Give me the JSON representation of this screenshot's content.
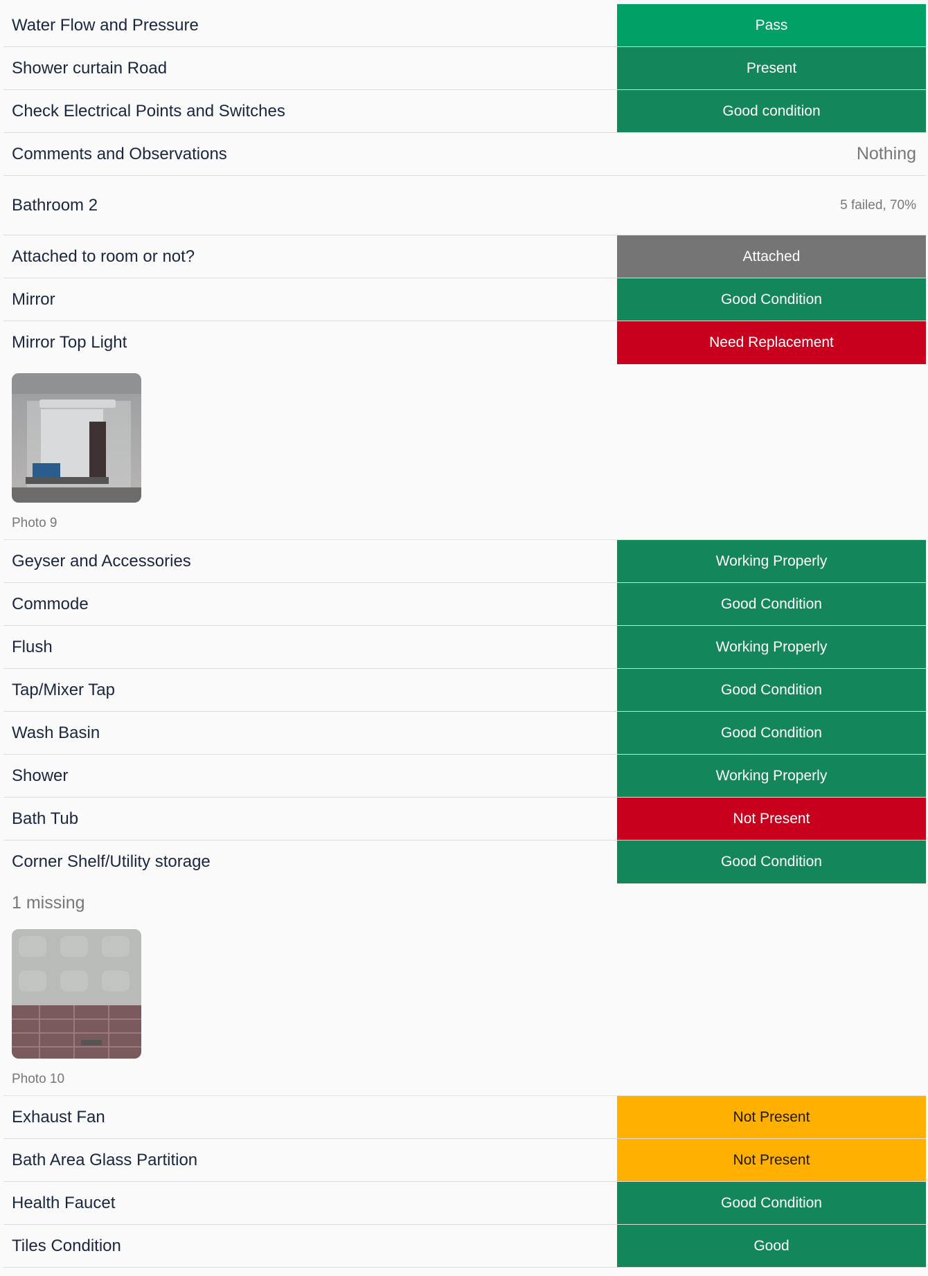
{
  "colors": {
    "pass": "#00a066",
    "good": "#14875a",
    "fail": "#c8001e",
    "warn": "#ffb000",
    "neutral": "#757575"
  },
  "top_rows": [
    {
      "label": "Water Flow and Pressure",
      "status": "Pass",
      "kind": "pass"
    },
    {
      "label": "Shower curtain Road",
      "status": "Present",
      "kind": "good"
    },
    {
      "label": "Check Electrical Points and Switches",
      "status": "Good condition",
      "kind": "good"
    },
    {
      "label": "Comments and Observations",
      "status": "Nothing",
      "kind": "text"
    }
  ],
  "section": {
    "title": "Bathroom 2",
    "summary": "5 failed, 70%"
  },
  "rows_a": [
    {
      "label": "Attached to room or not?",
      "status": "Attached",
      "kind": "neutral"
    },
    {
      "label": "Mirror",
      "status": "Good Condition",
      "kind": "good"
    },
    {
      "label": "Mirror Top Light",
      "status": "Need Replacement",
      "kind": "fail"
    }
  ],
  "photo_9": {
    "caption": "Photo 9",
    "icon": "mirror-photo"
  },
  "rows_b": [
    {
      "label": "Geyser and Accessories",
      "status": "Working Properly",
      "kind": "good"
    },
    {
      "label": "Commode",
      "status": "Good Condition",
      "kind": "good"
    },
    {
      "label": "Flush",
      "status": "Working Properly",
      "kind": "good"
    },
    {
      "label": "Tap/Mixer Tap",
      "status": "Good Condition",
      "kind": "good"
    },
    {
      "label": "Wash Basin",
      "status": "Good Condition",
      "kind": "good"
    },
    {
      "label": "Shower",
      "status": "Working Properly",
      "kind": "good"
    },
    {
      "label": "Bath Tub",
      "status": "Not Present",
      "kind": "fail"
    },
    {
      "label": "Corner Shelf/Utility storage",
      "status": "Good Condition",
      "kind": "good"
    }
  ],
  "note_missing": "1 missing",
  "photo_10": {
    "caption": "Photo 10",
    "icon": "tiles-photo"
  },
  "rows_c": [
    {
      "label": "Exhaust Fan",
      "status": "Not Present",
      "kind": "warn"
    },
    {
      "label": "Bath Area Glass Partition",
      "status": "Not Present",
      "kind": "warn"
    },
    {
      "label": "Health Faucet",
      "status": "Good Condition",
      "kind": "good"
    },
    {
      "label": "Tiles Condition",
      "status": "Good",
      "kind": "good"
    }
  ]
}
